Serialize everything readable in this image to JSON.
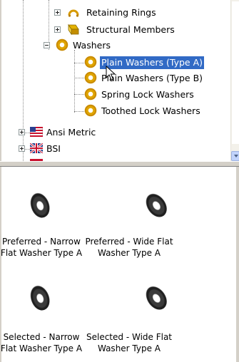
{
  "tree": {
    "items": [
      {
        "label": "Retaining Rings",
        "icon": "folder-ring-icon",
        "expander": "plus"
      },
      {
        "label": "Structural Members",
        "icon": "structural-member-icon",
        "expander": "plus"
      },
      {
        "label": "Washers",
        "icon": "washer-ring-icon",
        "expander": "minus"
      },
      {
        "label": "Plain Washers (Type A)",
        "icon": "washer-ring-icon",
        "selected": true
      },
      {
        "label": "Plain Washers (Type B)",
        "icon": "washer-ring-icon"
      },
      {
        "label": "Spring Lock Washers",
        "icon": "washer-ring-icon"
      },
      {
        "label": "Toothed Lock Washers",
        "icon": "washer-ring-icon"
      },
      {
        "label": "Ansi Metric",
        "icon": "us-flag-icon",
        "expander": "plus"
      },
      {
        "label": "BSI",
        "icon": "uk-flag-icon",
        "expander": "plus"
      }
    ]
  },
  "preview": {
    "tiles": [
      {
        "caption_line1": "Preferred - Narrow",
        "caption_line2": "Flat Washer Type A"
      },
      {
        "caption_line1": "Preferred - Wide Flat",
        "caption_line2": "Washer Type A"
      },
      {
        "caption_line1": "Selected - Narrow",
        "caption_line2": "Flat Washer Type A"
      },
      {
        "caption_line1": "Selected - Wide Flat",
        "caption_line2": "Washer Type A"
      }
    ]
  },
  "colors": {
    "selection": "#316ac5",
    "washer_icon": "#e0a500",
    "washer_thumb": "#2a2a2a"
  }
}
